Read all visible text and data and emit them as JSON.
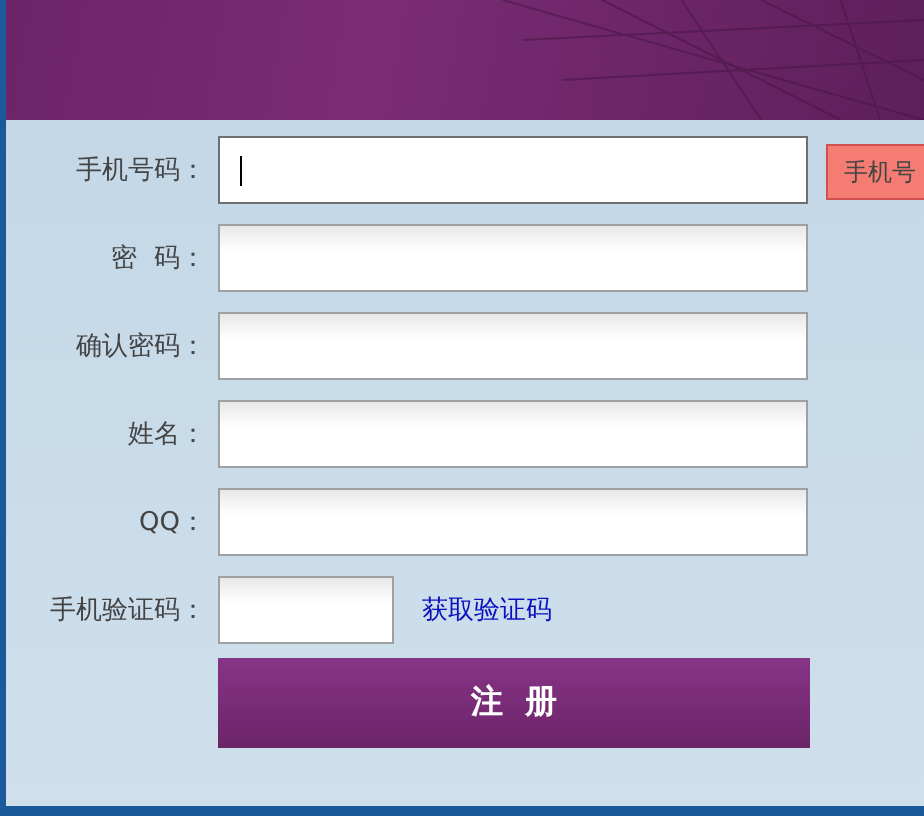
{
  "form": {
    "fields": [
      {
        "label": "手机号码：",
        "kind": "text",
        "focused": true
      },
      {
        "label": "密  码：",
        "kind": "text",
        "focused": false
      },
      {
        "label": "确认密码：",
        "kind": "text",
        "focused": false
      },
      {
        "label": "姓名：",
        "kind": "text",
        "focused": false
      },
      {
        "label": "QQ：",
        "kind": "text",
        "focused": false
      },
      {
        "label": "手机验证码：",
        "kind": "code",
        "focused": false,
        "link": "获取验证码"
      }
    ],
    "tooltip": "手机号",
    "submit": "注  册"
  }
}
